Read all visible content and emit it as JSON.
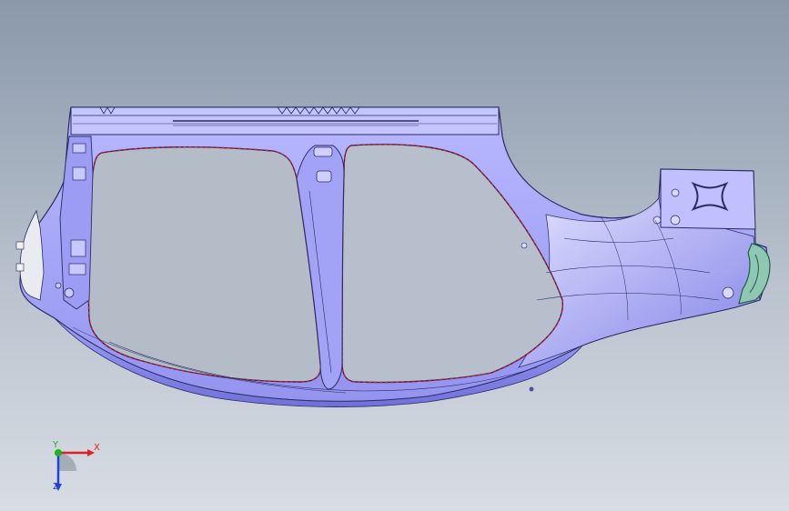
{
  "viewport": {
    "background_top": "#8a98aa",
    "background_bottom": "#d8dde4"
  },
  "model": {
    "part_fill": "#aeaeff",
    "part_shade": "#8c8cf0",
    "edge_color": "#2a2a66",
    "seal_color": "#cc2222",
    "trim_color": "#3aa37a"
  },
  "triad": {
    "x_label": "X",
    "y_label": "Y",
    "z_label": "Z",
    "x_color": "#e02020",
    "y_color": "#20b020",
    "z_color": "#2040e0"
  }
}
